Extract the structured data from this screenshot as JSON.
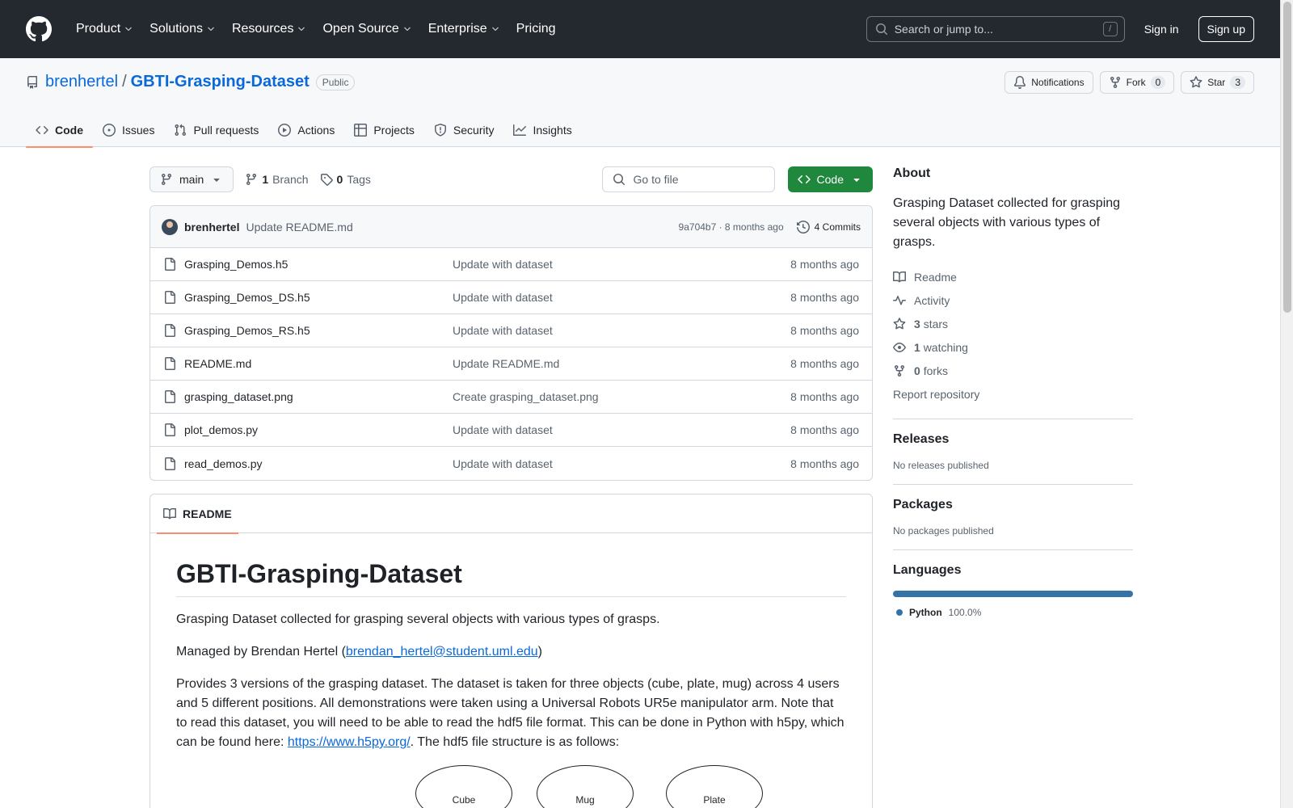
{
  "header": {
    "nav": [
      "Product",
      "Solutions",
      "Resources",
      "Open Source",
      "Enterprise",
      "Pricing"
    ],
    "search_placeholder": "Search or jump to...",
    "search_shortcut": "/",
    "signin": "Sign in",
    "signup": "Sign up"
  },
  "repo": {
    "owner": "brenhertel",
    "separator": "/",
    "name": "GBTI-Grasping-Dataset",
    "visibility": "Public",
    "notifications": "Notifications",
    "fork_label": "Fork",
    "fork_count": "0",
    "star_label": "Star",
    "star_count": "3",
    "tabs": [
      "Code",
      "Issues",
      "Pull requests",
      "Actions",
      "Projects",
      "Security",
      "Insights"
    ]
  },
  "toolbar": {
    "branch": "main",
    "branch_count": "1",
    "branch_label": "Branch",
    "tag_count": "0",
    "tag_label": "Tags",
    "goto_placeholder": "Go to file",
    "code_button": "Code"
  },
  "commit": {
    "author": "brenhertel",
    "message": "Update README.md",
    "meta": "9a704b7 · 8 months ago",
    "commits": "4 Commits"
  },
  "files": [
    {
      "name": "Grasping_Demos.h5",
      "message": "Update with dataset",
      "age": "8 months ago"
    },
    {
      "name": "Grasping_Demos_DS.h5",
      "message": "Update with dataset",
      "age": "8 months ago"
    },
    {
      "name": "Grasping_Demos_RS.h5",
      "message": "Update with dataset",
      "age": "8 months ago"
    },
    {
      "name": "README.md",
      "message": "Update README.md",
      "age": "8 months ago"
    },
    {
      "name": "grasping_dataset.png",
      "message": "Create grasping_dataset.png",
      "age": "8 months ago"
    },
    {
      "name": "plot_demos.py",
      "message": "Update with dataset",
      "age": "8 months ago"
    },
    {
      "name": "read_demos.py",
      "message": "Update with dataset",
      "age": "8 months ago"
    }
  ],
  "readme": {
    "tab": "README",
    "title": "GBTI-Grasping-Dataset",
    "intro": "Grasping Dataset collected for grasping several objects with various types of grasps.",
    "managed_prefix": "Managed by Brendan Hertel (",
    "managed_email": "brendan_hertel@student.uml.edu",
    "managed_suffix": ")",
    "body_prefix": "Provides 3 versions of the grasping dataset. The dataset is taken for three objects (cube, plate, mug) across 4 users and 5 different positions. All demonstrations were taken using a Universal Robots UR5e manipulator arm. Note that to read this dataset, you will need to be able to read the hdf5 file format. This can be done in Python with h5py, which can be found here: ",
    "body_link": "https://www.h5py.org/",
    "body_suffix": ". The hdf5 file structure is as follows:",
    "diagram_nodes": [
      "Cube",
      "Mug",
      "Plate"
    ]
  },
  "sidebar": {
    "about_title": "About",
    "description": "Grasping Dataset collected for grasping several objects with various types of grasps.",
    "readme": "Readme",
    "activity": "Activity",
    "stars_count": "3",
    "stars_label": "stars",
    "watching_count": "1",
    "watching_label": "watching",
    "forks_count": "0",
    "forks_label": "forks",
    "report": "Report repository",
    "releases_title": "Releases",
    "releases_empty": "No releases published",
    "packages_title": "Packages",
    "packages_empty": "No packages published",
    "languages_title": "Languages",
    "language_name": "Python",
    "language_pct": "100.0%",
    "language_color": "#3572A5"
  }
}
